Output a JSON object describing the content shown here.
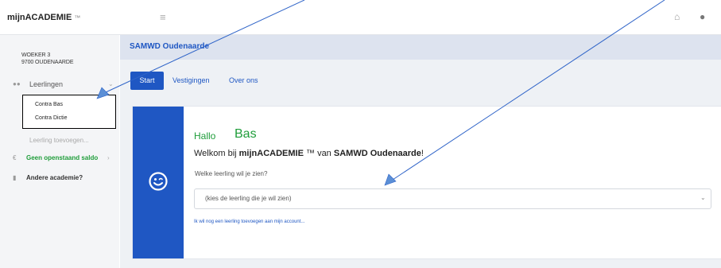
{
  "app": {
    "brand": "mijnACADEMIE",
    "brand_tm": "™"
  },
  "header": {
    "menu_icon": "hamburger-icon",
    "home_icon": "home-icon",
    "user_icon": "user-icon"
  },
  "sidebar": {
    "address_line1": "WOEKER 3",
    "address_line2": "9700 OUDENAARDE",
    "leerlingen": {
      "label": "Leerlingen",
      "icon": "users-icon"
    },
    "students": [
      "Contra Bas",
      "Contra Dictie"
    ],
    "add_student": "Leerling toevoegen...",
    "saldo": {
      "label": "Geen openstaand saldo",
      "icon": "euro-icon"
    },
    "andere": {
      "label": "Andere academie?",
      "icon": "building-icon"
    }
  },
  "page": {
    "title": "SAMWD Oudenaarde",
    "tabs": [
      {
        "label": "Start",
        "active": true
      },
      {
        "label": "Vestigingen",
        "active": false
      },
      {
        "label": "Over ons",
        "active": false
      }
    ]
  },
  "card": {
    "icon": "smile-icon",
    "hallo": "Hallo",
    "name": "Bas",
    "welkom_pre": "Welkom bij",
    "welkom_brand": "mijnACADEMIE",
    "welkom_tm": "™",
    "welkom_mid": "van",
    "welkom_school": "SAMWD Oudenaarde",
    "welkom_end": "!",
    "question": "Welke leerling wil je zien?",
    "select_placeholder": "(kies de leerling die je wil zien)",
    "add_link": "Ik wil nog een leerling toevoegen aan mijn account..."
  },
  "colors": {
    "primary": "#1f57c3",
    "success": "#1f9d3a",
    "annotation": "#1f57c3"
  }
}
